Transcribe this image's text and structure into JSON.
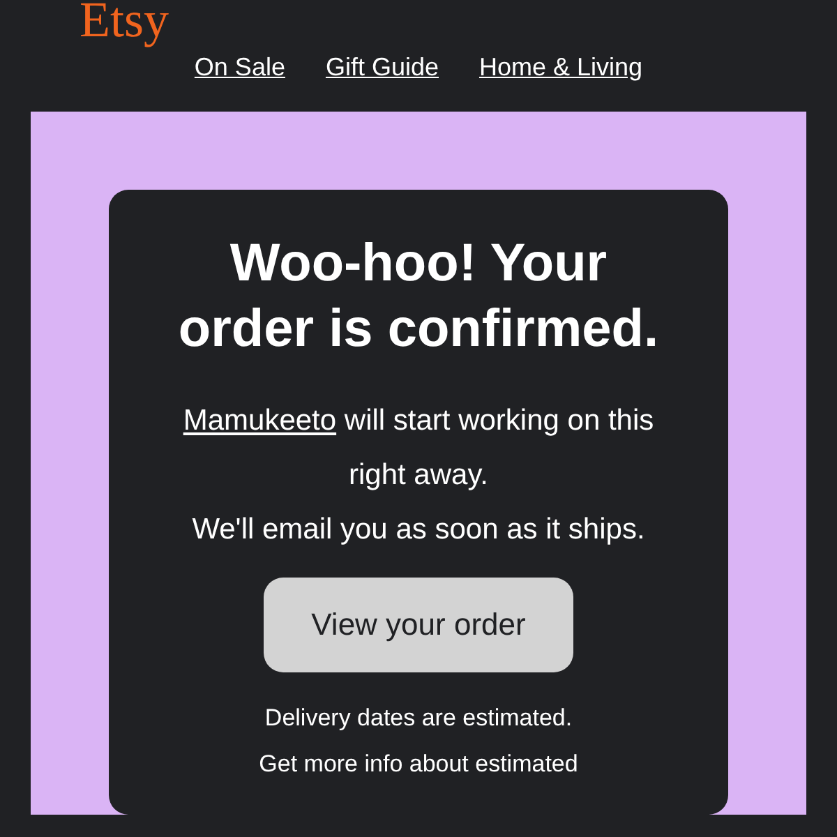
{
  "logo": "Etsy",
  "nav": [
    {
      "label": "On Sale"
    },
    {
      "label": "Gift Guide"
    },
    {
      "label": "Home & Living"
    }
  ],
  "card": {
    "heading": "Woo-hoo! Your order is confirmed.",
    "shop": "Mamukeeto",
    "message_after_shop": " will start working on this right away.",
    "message_2": "We'll email you as soon as it ships.",
    "button": "View your order",
    "note_1": "Delivery dates are estimated.",
    "note_2": "Get more info about estimated"
  }
}
